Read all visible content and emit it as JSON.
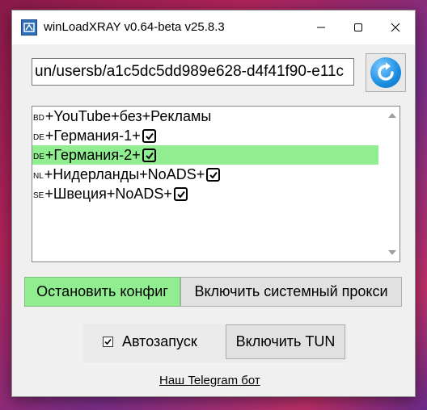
{
  "window": {
    "title": "winLoadXRAY v0.64-beta v25.8.3"
  },
  "url_field": {
    "value": "un/usersb/a1c5dc5dd989e628-d4f41f90-e11c"
  },
  "servers": [
    {
      "flag": "BD",
      "name": "+YouTube+без+Рекламы",
      "checked": false,
      "selected": false
    },
    {
      "flag": "DE",
      "name": "+Германия-1+",
      "checked": true,
      "selected": false
    },
    {
      "flag": "DE",
      "name": "+Германия-2+",
      "checked": true,
      "selected": true
    },
    {
      "flag": "NL",
      "name": "+Нидерланды+NoADS+",
      "checked": true,
      "selected": false
    },
    {
      "flag": "SE",
      "name": "+Швеция+NoADS+",
      "checked": true,
      "selected": false
    }
  ],
  "buttons": {
    "stop_config": "Остановить конфиг",
    "system_proxy": "Включить системный прокси",
    "tun": "Включить TUN"
  },
  "autostart": {
    "label": "Автозапуск",
    "checked": true
  },
  "telegram_link": "Наш Telegram бот",
  "colors": {
    "selected_row": "#90ee90",
    "active_button": "#90ee90"
  }
}
